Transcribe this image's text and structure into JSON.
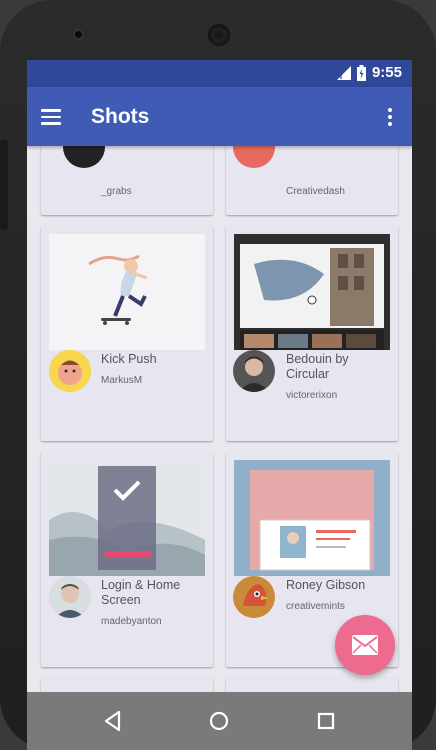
{
  "status_bar": {
    "time": "9:55"
  },
  "app_bar": {
    "title": "Shots"
  },
  "shots": [
    {
      "title": "",
      "author": "_grabs"
    },
    {
      "title": "",
      "author": "Creativedash"
    },
    {
      "title": "Kick Push",
      "author": "MarkusM"
    },
    {
      "title": "Bedouin by Circular",
      "author": "victorerixon"
    },
    {
      "title": "Login & Home Screen",
      "author": "madebyanton"
    },
    {
      "title": "Roney Gibson",
      "author": "creativemints"
    }
  ],
  "colors": {
    "status_bar": "#2f4898",
    "app_bar": "#3f5bb5",
    "card_bg": "#e6e5f0",
    "fab": "#ec6b8f",
    "nav_bar": "#7a7a7a"
  },
  "icons": {
    "menu": "menu-icon",
    "overflow": "more-vert-icon",
    "fab": "mail-icon",
    "back": "back-icon",
    "home": "home-icon",
    "recents": "recents-icon"
  }
}
